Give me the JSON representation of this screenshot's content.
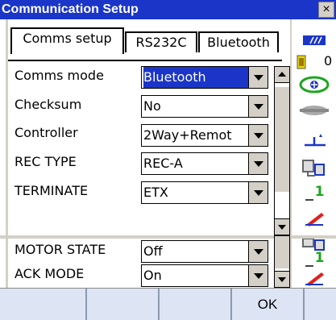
{
  "window": {
    "title": "Communication Setup",
    "close_label": "×"
  },
  "tabs": [
    {
      "label": "Comms setup",
      "active": true
    },
    {
      "label": "RS232C",
      "active": false
    },
    {
      "label": "Bluetooth",
      "active": false
    }
  ],
  "fields_top": [
    {
      "label": "Comms mode",
      "value": "Bluetooth",
      "highlighted": true
    },
    {
      "label": "Checksum",
      "value": "No"
    },
    {
      "label": "Controller",
      "value": "2Way+Remot"
    },
    {
      "label": "REC TYPE",
      "value": "REC-A"
    },
    {
      "label": "TERMINATE",
      "value": "ETX"
    }
  ],
  "fields_bottom": [
    {
      "label": "MOTOR STATE",
      "value": "Off"
    },
    {
      "label": "ACK MODE",
      "value": "On"
    }
  ],
  "status": {
    "battery_count": "0",
    "memory_1": "1",
    "memory_2": "1"
  },
  "softkeys": [
    "",
    "",
    "",
    "OK",
    ""
  ],
  "colors": {
    "title_bar": "#1a35c8",
    "selection": "#1a35c8",
    "softkey_bg": "#dde4f4",
    "status_green": "#1ea51e",
    "battery_yellow": "#e8d800"
  },
  "icons": [
    "signal-icon",
    "battery-icon",
    "target-icon",
    "prism-icon",
    "tilt-icon",
    "comm-icon",
    "memory-icon",
    "edit-icon"
  ]
}
